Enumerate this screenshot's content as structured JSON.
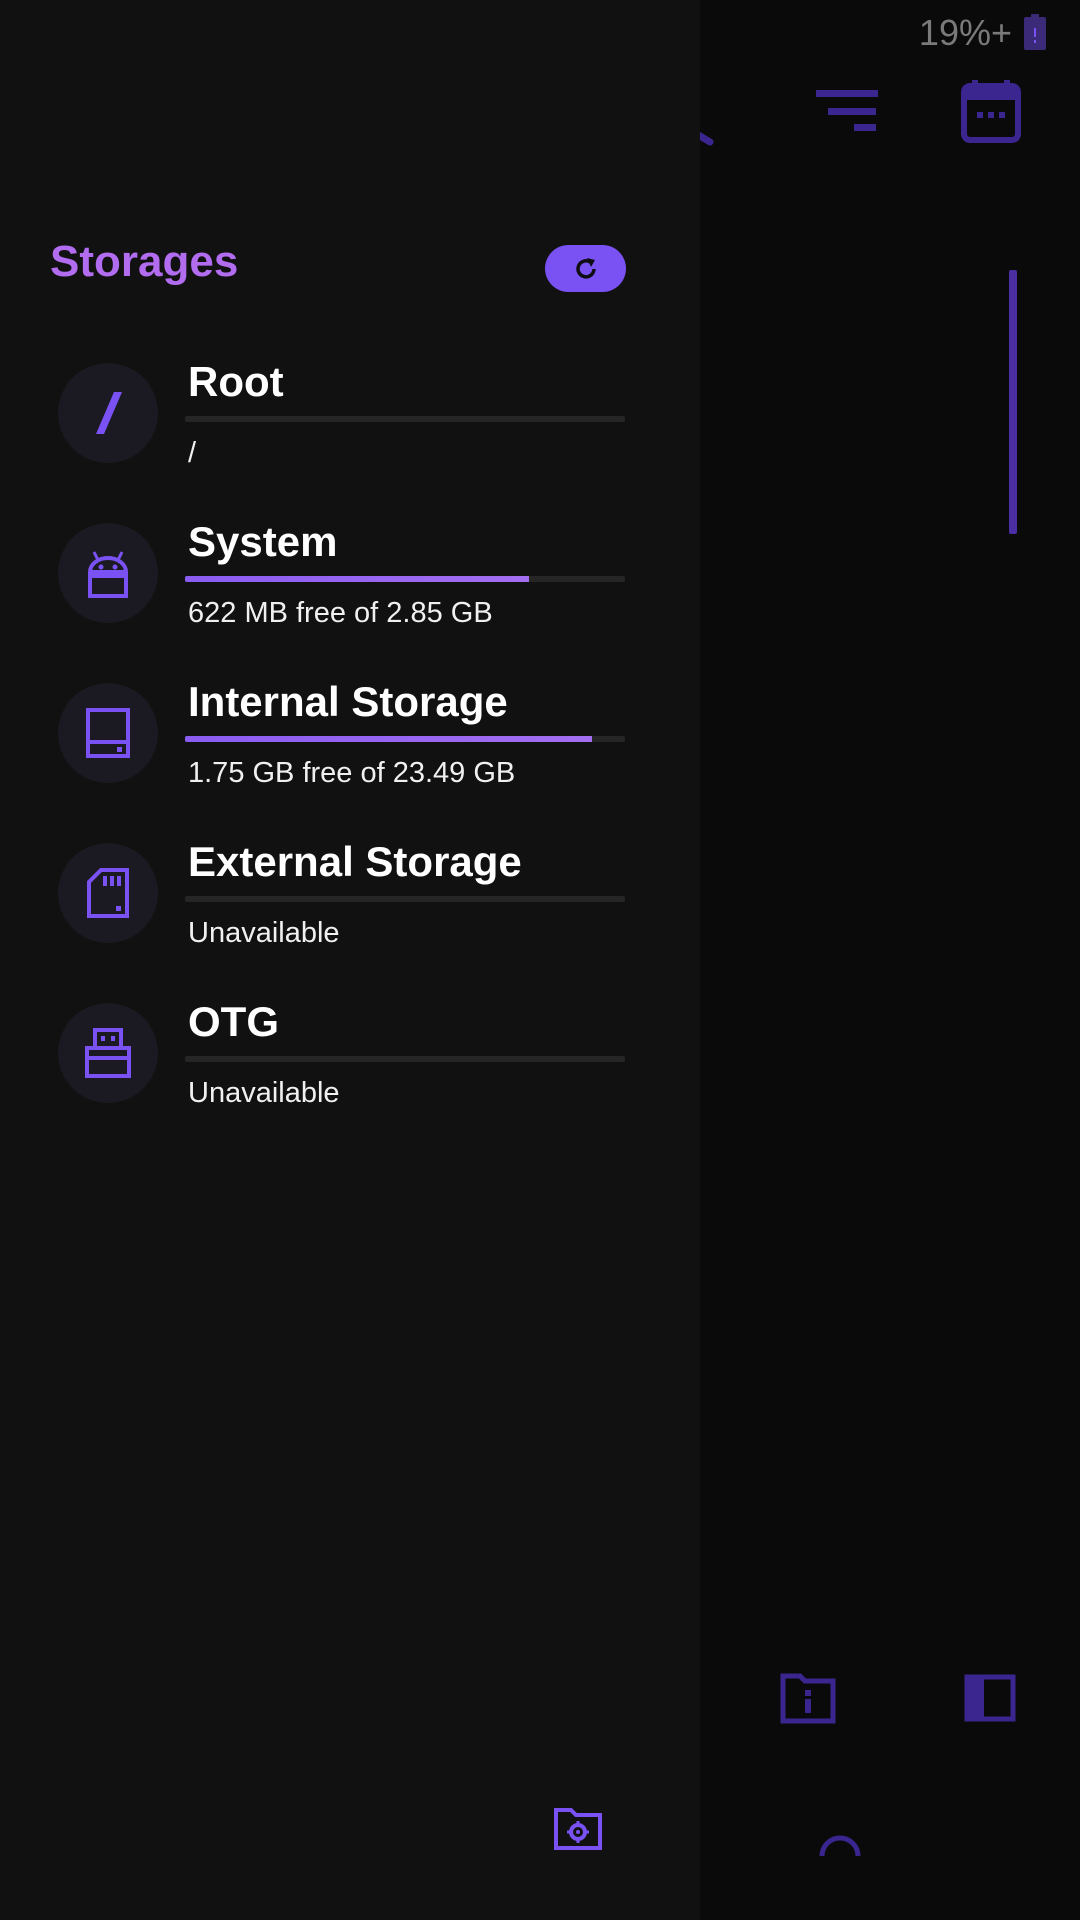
{
  "status_bar": {
    "battery_text": "19%+",
    "battery_icon": "battery-icon"
  },
  "toolbar": {
    "icons": [
      "search-icon",
      "filter-icon",
      "calendar-icon"
    ]
  },
  "drawer": {
    "title": "Storages",
    "refresh_icon": "refresh-icon",
    "storages": [
      {
        "name": "Root",
        "icon_text": "/",
        "detail": "/",
        "used_fraction": 0
      },
      {
        "name": "System",
        "icon": "android-icon",
        "detail": "622 MB free of 2.85 GB",
        "used_fraction": 0.782
      },
      {
        "name": "Internal Storage",
        "icon": "internal-storage-icon",
        "detail": "1.75 GB free of 23.49 GB",
        "used_fraction": 0.925
      },
      {
        "name": "External Storage",
        "icon": "sd-card-icon",
        "detail": "Unavailable",
        "used_fraction": 0
      },
      {
        "name": "OTG",
        "icon": "usb-icon",
        "detail": "Unavailable",
        "used_fraction": 0
      }
    ],
    "footer_icon": "folder-settings-icon"
  },
  "bottom_bar": {
    "icons": [
      "folder-info-icon",
      "panel-icon",
      "arc-icon"
    ]
  },
  "colors": {
    "accent": "#7a52f4",
    "title": "#b16cf0",
    "drawer_bg": "#111111",
    "dim_icon": "#4b2ea3"
  }
}
